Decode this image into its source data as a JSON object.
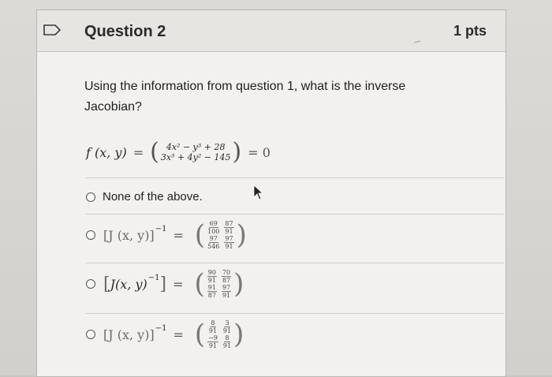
{
  "header": {
    "title": "Question 2",
    "points": "1 pts"
  },
  "question": {
    "text": "Using the information from question 1, what is the inverse Jacobian?",
    "function": {
      "lhs": "f (x, y)",
      "equals": "=",
      "top": "4x² − y³ + 28",
      "bottom": "3x³ + 4y² − 145",
      "rhs": "= 0"
    }
  },
  "options": [
    {
      "label": "None of the above."
    },
    {
      "expr": "[J (x, y)]",
      "exponent": "−1",
      "equals": "=",
      "matrix": [
        [
          {
            "num": "69",
            "den": "100"
          },
          {
            "num": "87",
            "den": "91"
          }
        ],
        [
          {
            "num": "97",
            "den": "546"
          },
          {
            "num": "97",
            "den": "91"
          }
        ]
      ]
    },
    {
      "expr": "J(x, y)",
      "exponent": "−1",
      "equals": "=",
      "matrix": [
        [
          {
            "num": "90",
            "den": "91"
          },
          {
            "num": "70",
            "den": "87"
          }
        ],
        [
          {
            "num": "91",
            "den": "87"
          },
          {
            "num": "97",
            "den": "91"
          }
        ]
      ]
    },
    {
      "expr": "[J (x, y)]",
      "exponent": "−1",
      "equals": "=",
      "matrix": [
        [
          {
            "num": "8",
            "den": "91"
          },
          {
            "num": "3",
            "den": "91"
          }
        ],
        [
          {
            "num": "−9",
            "den": "91"
          },
          {
            "num": "8",
            "den": "91"
          }
        ]
      ]
    }
  ],
  "icons": {
    "flag": "flag-icon",
    "cursor": "mouse-cursor-icon",
    "radio": "radio-icon"
  },
  "colors": {
    "card_bg": "#f2f1ef",
    "header_bg": "#e6e5e2",
    "text": "#1f1f1f"
  }
}
